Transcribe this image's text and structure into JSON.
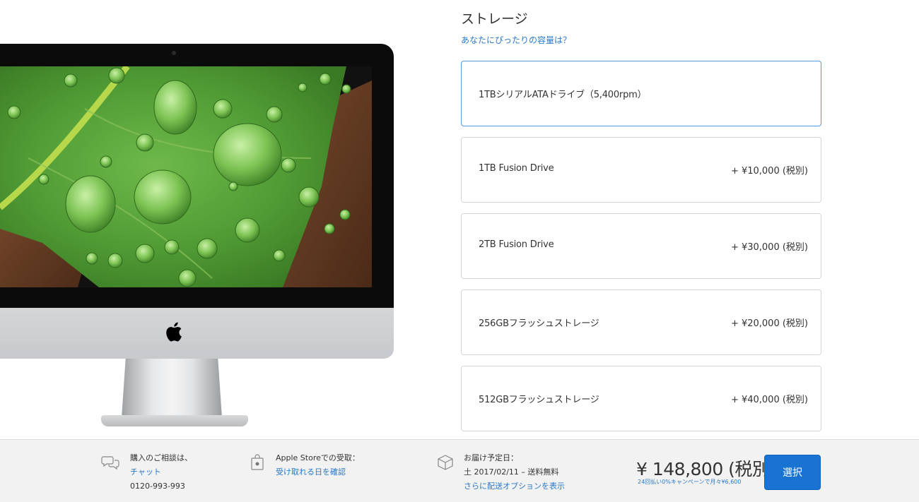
{
  "storage": {
    "title": "ストレージ",
    "help_link": "あなたにぴったりの容量は？",
    "options": [
      {
        "label": "1TBシリアルATAドライブ（5,400rpm）",
        "price": "",
        "selected": true
      },
      {
        "label": "1TB Fusion Drive",
        "price": "+ ¥10,000 (税別)",
        "selected": false
      },
      {
        "label": "2TB Fusion Drive",
        "price": "+ ¥30,000 (税別)",
        "selected": false
      },
      {
        "label": "256GBフラッシュストレージ",
        "price": "+ ¥20,000 (税別)",
        "selected": false
      },
      {
        "label": "512GBフラッシュストレージ",
        "price": "+ ¥40,000 (税別)",
        "selected": false
      }
    ]
  },
  "footer": {
    "consult": {
      "label": "購入のご相談は、",
      "link": "チャット",
      "phone": "0120-993-993",
      "icon": "chat-bubbles-icon"
    },
    "pickup": {
      "label": "Apple Storeでの受取：",
      "link": "受け取れる日を確認",
      "icon": "shopping-bag-icon"
    },
    "delivery": {
      "label": "お届け予定日：",
      "date": "土 2017/02/11 – 送料無料",
      "link": "さらに配送オプションを表示",
      "icon": "box-icon"
    },
    "price": "¥ 148,800 (税別)",
    "campaign": "24回払い0%キャンペーンで月々¥6,600",
    "select_label": "選択"
  },
  "colors": {
    "link": "#2a78c7",
    "button": "#1873d2",
    "selected_border": "#5a99e0"
  }
}
